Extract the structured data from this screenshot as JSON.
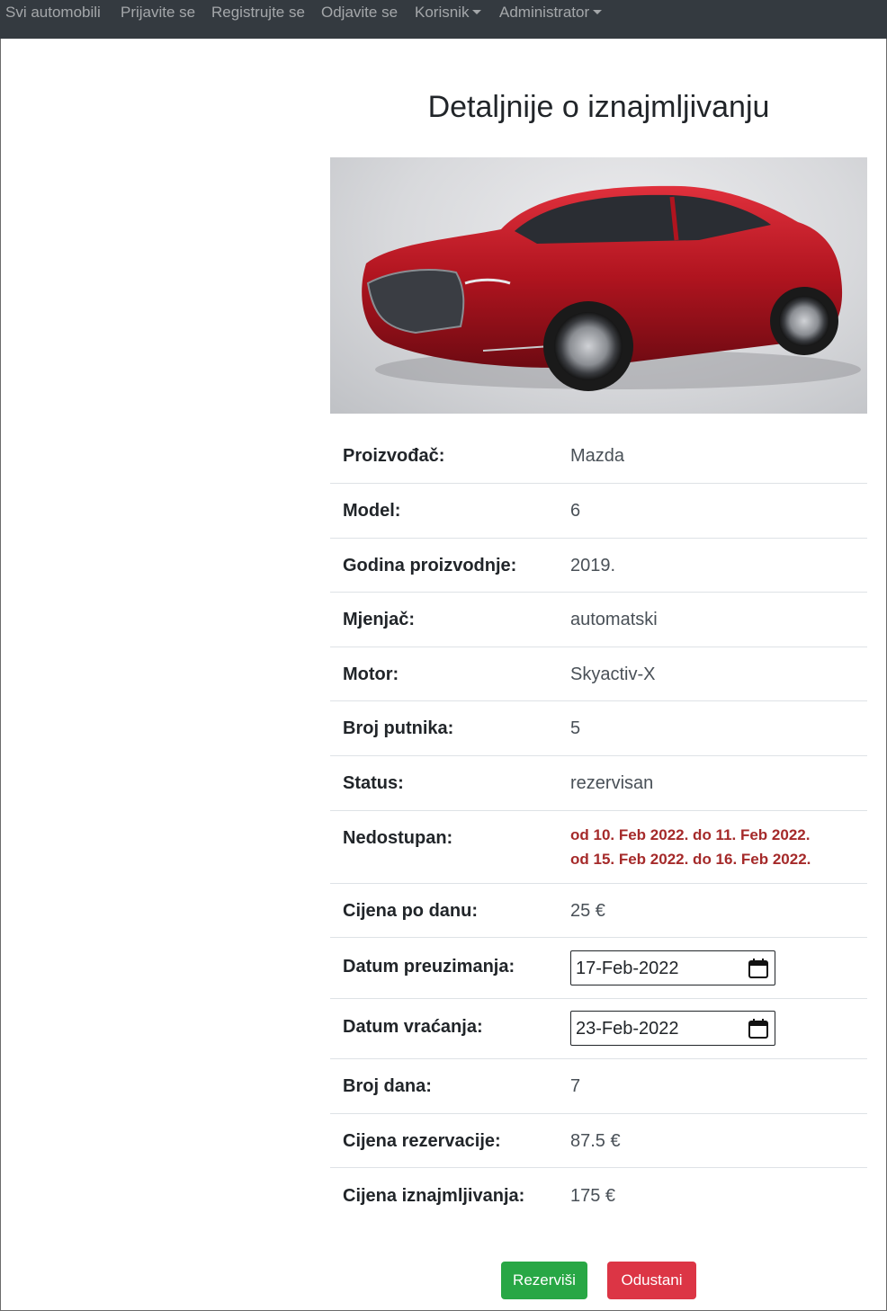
{
  "nav": {
    "items": [
      {
        "label": "Svi automobili"
      },
      {
        "label": "Prijavite se"
      },
      {
        "label": "Registrujte se"
      },
      {
        "label": "Odjavite se"
      },
      {
        "label": "Korisnik"
      },
      {
        "label": "Administrator"
      }
    ]
  },
  "page": {
    "title": "Detaljnije o iznajmljivanju"
  },
  "details": {
    "proizvodjac": {
      "label": "Proizvođač:",
      "value": "Mazda"
    },
    "model": {
      "label": "Model:",
      "value": "6"
    },
    "godina": {
      "label": "Godina proizvodnje:",
      "value": "2019."
    },
    "mjenjac": {
      "label": "Mjenjač:",
      "value": "automatski"
    },
    "motor": {
      "label": "Motor:",
      "value": "Skyactiv-X"
    },
    "broj_putnika": {
      "label": "Broj putnika:",
      "value": "5"
    },
    "status": {
      "label": "Status:",
      "value": "rezervisan"
    },
    "nedostupan": {
      "label": "Nedostupan:",
      "periods": [
        "od 10. Feb 2022. do 11. Feb 2022.",
        "od 15. Feb 2022. do 16. Feb 2022."
      ]
    },
    "cijena_po_danu": {
      "label": "Cijena po danu:",
      "value": "25 €"
    },
    "datum_preuzimanja": {
      "label": "Datum preuzimanja:",
      "value": "17-Feb-2022"
    },
    "datum_vracanja": {
      "label": "Datum vraćanja:",
      "value": "23-Feb-2022"
    },
    "broj_dana": {
      "label": "Broj dana:",
      "value": "7"
    },
    "cijena_rezervacije": {
      "label": "Cijena rezervacije:",
      "value": "87.5 €"
    },
    "cijena_iznajmljivanja": {
      "label": "Cijena iznajmljivanja:",
      "value": "175 €"
    }
  },
  "actions": {
    "reserve_label": "Rezerviši",
    "cancel_label": "Odustani"
  },
  "colors": {
    "navbar": "#343a40",
    "unavailable_text": "#a52a2a",
    "reserve_button": "#28a745",
    "cancel_button": "#dc3545",
    "car_body": "#b0141f"
  }
}
